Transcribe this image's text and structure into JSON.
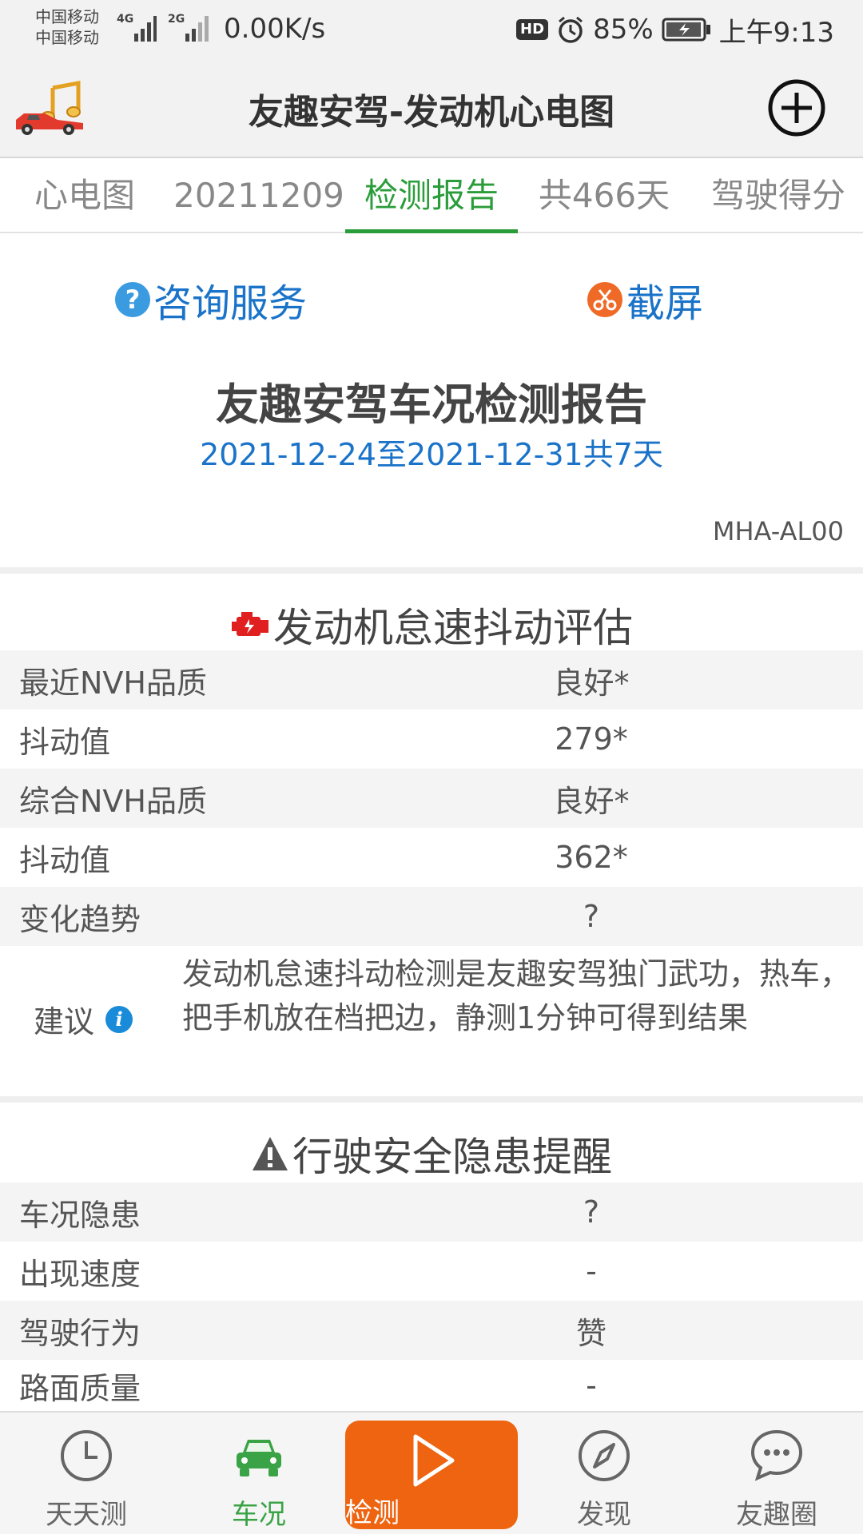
{
  "status_bar": {
    "carrier1": "中国移动",
    "carrier2": "中国移动",
    "net1": "4G",
    "net2": "2G",
    "speed": "0.00K/s",
    "hd": "HD",
    "battery": "85%",
    "time": "上午9:13"
  },
  "header": {
    "title": "友趣安驾-发动机心电图"
  },
  "tabs": [
    {
      "label": "心电图"
    },
    {
      "label": "20211209"
    },
    {
      "label": "检测报告"
    },
    {
      "label": "共466天"
    },
    {
      "label": "驾驶得分"
    }
  ],
  "links": {
    "consult_icon": "?",
    "consult": "咨询服务",
    "screenshot": "截屏"
  },
  "report": {
    "title": "友趣安驾车况检测报告",
    "range": "2021-12-24至2021-12-31共7天",
    "device": "MHA-AL00"
  },
  "engine_section": {
    "title": "发动机怠速抖动评估",
    "rows": [
      {
        "label": "最近NVH品质",
        "value": "良好*"
      },
      {
        "label": "抖动值",
        "value": "279*"
      },
      {
        "label": "综合NVH品质",
        "value": "良好*"
      },
      {
        "label": "抖动值",
        "value": "362*"
      },
      {
        "label": "变化趋势",
        "value": "?"
      }
    ],
    "advice_label": "建议",
    "advice_icon": "i",
    "advice_text": "发动机怠速抖动检测是友趣安驾独门武功，热车，把手机放在档把边，静测1分钟可得到结果"
  },
  "safety_section": {
    "title": "行驶安全隐患提醒",
    "rows": [
      {
        "label": "车况隐患",
        "value": "?"
      },
      {
        "label": "出现速度",
        "value": "-"
      },
      {
        "label": "驾驶行为",
        "value": "赞"
      },
      {
        "label": "路面质量",
        "value": "-"
      }
    ]
  },
  "bottom_nav": [
    {
      "label": "天天测"
    },
    {
      "label": "车况"
    },
    {
      "label": "检测"
    },
    {
      "label": "发现"
    },
    {
      "label": "友趣圈"
    }
  ],
  "colors": {
    "accent_green": "#2a9d3a",
    "link_blue": "#1a73c9",
    "center_orange": "#ee6411"
  }
}
